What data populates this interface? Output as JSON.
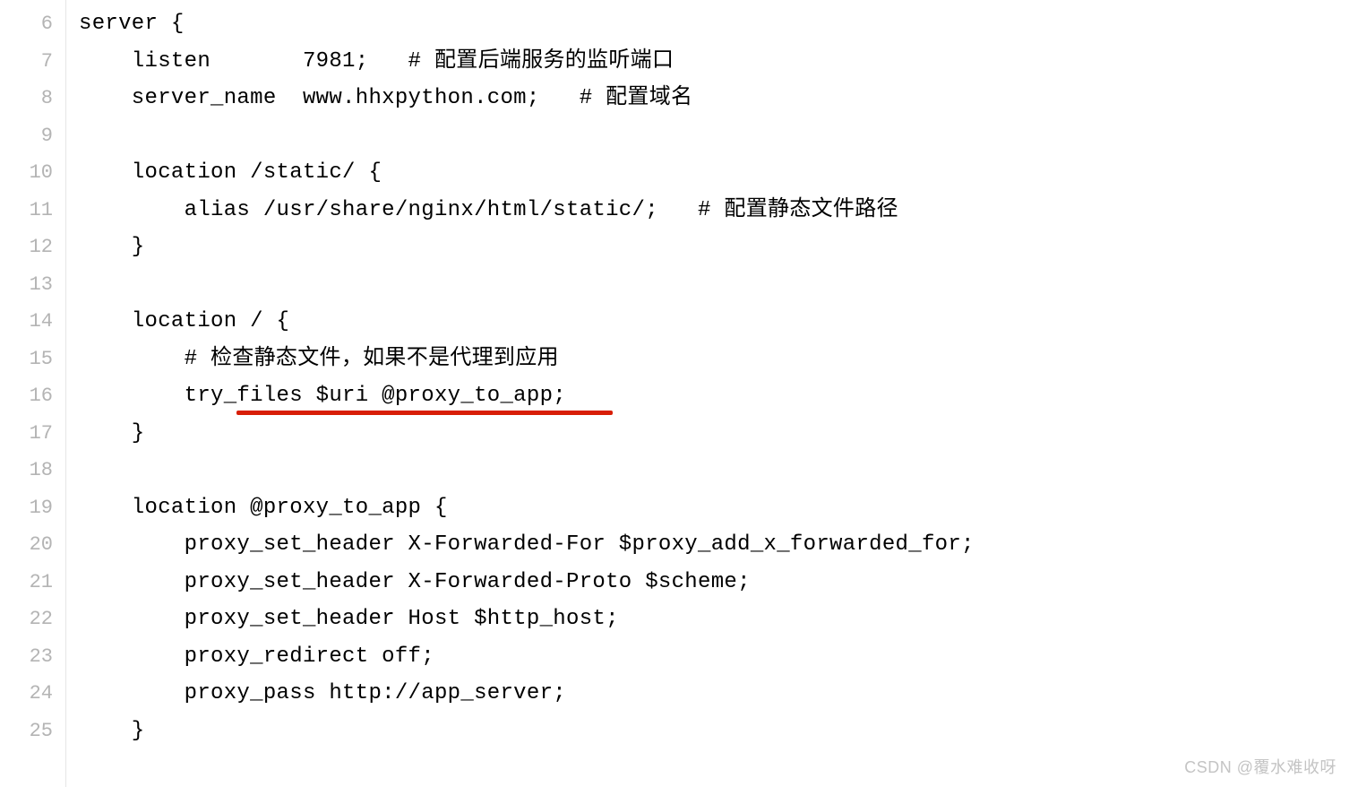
{
  "lines": [
    {
      "num": "6",
      "text": "server {"
    },
    {
      "num": "7",
      "text": "    listen       7981;   # 配置后端服务的监听端口"
    },
    {
      "num": "8",
      "text": "    server_name  www.hhxpython.com;   # 配置域名"
    },
    {
      "num": "9",
      "text": ""
    },
    {
      "num": "10",
      "text": "    location /static/ {"
    },
    {
      "num": "11",
      "text": "        alias /usr/share/nginx/html/static/;   # 配置静态文件路径"
    },
    {
      "num": "12",
      "text": "    }"
    },
    {
      "num": "13",
      "text": ""
    },
    {
      "num": "14",
      "text": "    location / {"
    },
    {
      "num": "15",
      "text": "        # 检查静态文件，如果不是代理到应用"
    },
    {
      "num": "16",
      "text": "        try_files $uri @proxy_to_app;"
    },
    {
      "num": "17",
      "text": "    }"
    },
    {
      "num": "18",
      "text": ""
    },
    {
      "num": "19",
      "text": "    location @proxy_to_app {"
    },
    {
      "num": "20",
      "text": "        proxy_set_header X-Forwarded-For $proxy_add_x_forwarded_for;"
    },
    {
      "num": "21",
      "text": "        proxy_set_header X-Forwarded-Proto $scheme;"
    },
    {
      "num": "22",
      "text": "        proxy_set_header Host $http_host;"
    },
    {
      "num": "23",
      "text": "        proxy_redirect off;"
    },
    {
      "num": "24",
      "text": "        proxy_pass http://app_server;"
    },
    {
      "num": "25",
      "text": "    }"
    }
  ],
  "watermark": "CSDN @覆水难收呀"
}
